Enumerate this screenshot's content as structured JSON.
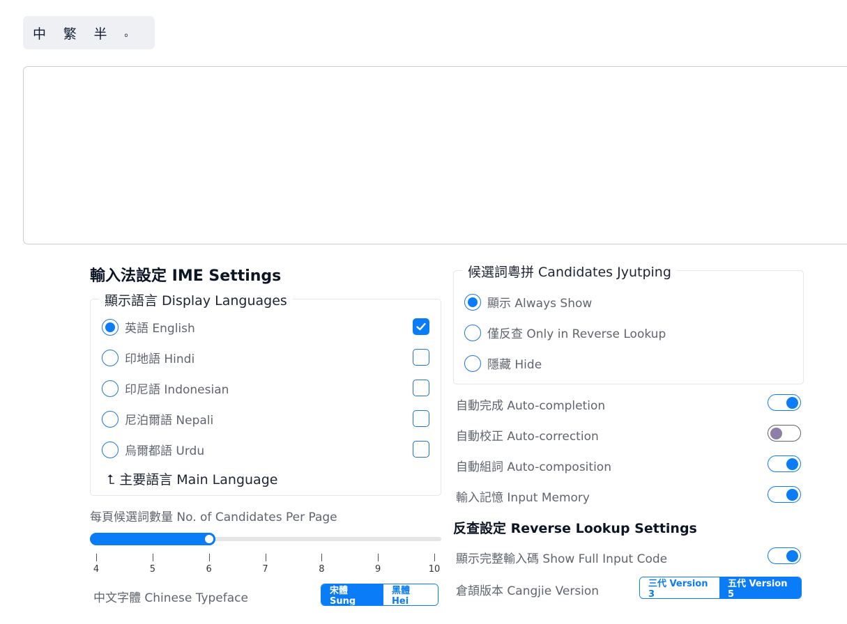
{
  "toolbar": {
    "buttons": [
      "中",
      "繁",
      "半",
      "。"
    ]
  },
  "ime_settings": {
    "title": "輸入法設定 IME Settings",
    "display_languages": {
      "legend": "顯示語言 Display Languages",
      "items": [
        {
          "label": "英語 English",
          "radio": true,
          "checked": true
        },
        {
          "label": "印地語 Hindi",
          "radio": false,
          "checked": false
        },
        {
          "label": "印尼語 Indonesian",
          "radio": false,
          "checked": false
        },
        {
          "label": "尼泊爾語 Nepali",
          "radio": false,
          "checked": false
        },
        {
          "label": "烏爾都語 Urdu",
          "radio": false,
          "checked": false
        }
      ],
      "main_language": "⮤ 主要語言 Main Language"
    },
    "candidates_per_page": {
      "label": "每頁候選詞數量 No. of Candidates Per Page",
      "ticks": [
        "4",
        "5",
        "6",
        "7",
        "8",
        "9",
        "10"
      ],
      "value": 6,
      "min": 4,
      "max": 10
    },
    "typeface": {
      "label": "中文字體 Chinese Typeface",
      "options": [
        "宋體 Sung",
        "黑體 Hei"
      ],
      "selected": 0
    }
  },
  "jyutping": {
    "legend": "候選詞粵拼 Candidates Jyutping",
    "options": [
      {
        "label": "顯示 Always Show",
        "selected": true
      },
      {
        "label": "僅反查 Only in Reverse Lookup",
        "selected": false
      },
      {
        "label": "隱藏 Hide",
        "selected": false
      }
    ]
  },
  "toggles": [
    {
      "label": "自動完成 Auto-completion",
      "on": true
    },
    {
      "label": "自動校正 Auto-correction",
      "on": false
    },
    {
      "label": "自動組詞 Auto-composition",
      "on": true
    },
    {
      "label": "輸入記憶 Input Memory",
      "on": true
    }
  ],
  "reverse_lookup": {
    "title": "反查設定 Reverse Lookup Settings",
    "full_code": {
      "label": "顯示完整輸入碼 Show Full Input Code",
      "on": true
    },
    "cangjie": {
      "label": "倉頡版本 Cangjie Version",
      "options": [
        "三代 Version 3",
        "五代 Version 5"
      ],
      "selected": 1
    }
  },
  "colors": {
    "accent": "#0a7cf7",
    "heading": "#0c1526",
    "text": "#5f646e"
  }
}
